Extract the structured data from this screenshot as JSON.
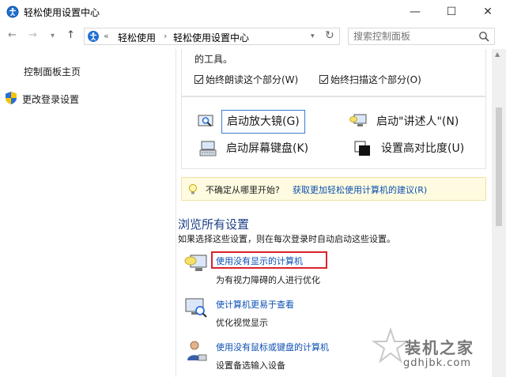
{
  "window": {
    "title": "轻松使用设置中心",
    "minimize_glyph": "—",
    "maximize_glyph": "☐",
    "close_glyph": "✕"
  },
  "address": {
    "chevron": "«",
    "crumbs": [
      "轻松使用",
      "轻松使用设置中心"
    ],
    "separator": "›",
    "search_placeholder": "搜索控制面板"
  },
  "sidebar": {
    "items": [
      {
        "label": "控制面板主页"
      },
      {
        "label": "更改登录设置"
      }
    ]
  },
  "tools": {
    "text": "的工具。",
    "checkbox_read": "始终朗读这个部分(W)",
    "checkbox_scan": "始终扫描这个部分(O)"
  },
  "quick_launch": {
    "magnifier": "启动放大镜(G)",
    "narrator": "启动\"讲述人\"(N)",
    "keyboard": "启动屏幕键盘(K)",
    "contrast": "设置高对比度(U)"
  },
  "info": {
    "question": "不确定从哪里开始?",
    "link": "获取更加轻松使用计算机的建议(R)"
  },
  "browse": {
    "heading": "浏览所有设置",
    "description": "如果选择这些设置，则在每次登录时自动启动这些设置。",
    "items": [
      {
        "title": "使用没有显示的计算机",
        "desc": "为有视力障碍的人进行优化",
        "icon": "display-speech-icon"
      },
      {
        "title": "使计算机更易于查看",
        "desc": "优化视觉显示",
        "icon": "monitor-magnifier-icon"
      },
      {
        "title": "使用没有鼠标或键盘的计算机",
        "desc": "设置备选输入设备",
        "icon": "person-icon"
      }
    ]
  },
  "watermark": {
    "title": "装机之家",
    "url": "gdhjbk.com"
  },
  "colors": {
    "link": "#0b4fb3",
    "heading": "#1d3f86",
    "highlight": "#d9232c",
    "info_bg": "#fefbe0"
  }
}
